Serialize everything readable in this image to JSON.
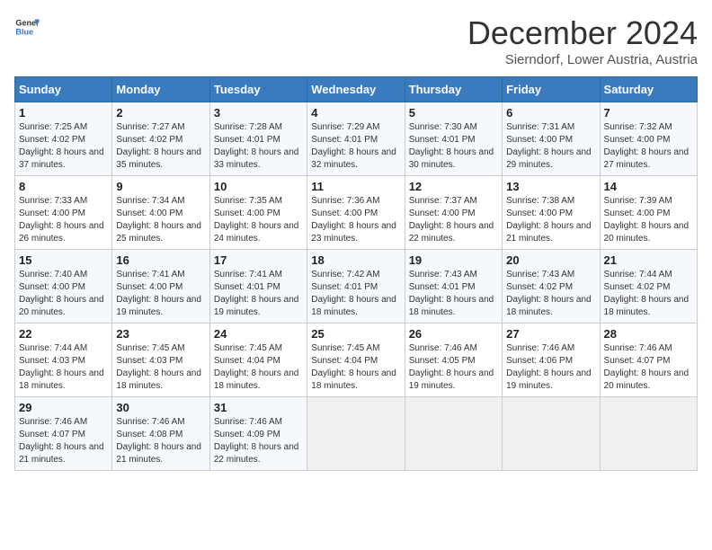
{
  "logo": {
    "general": "General",
    "blue": "Blue"
  },
  "title": "December 2024",
  "subtitle": "Sierndorf, Lower Austria, Austria",
  "days_of_week": [
    "Sunday",
    "Monday",
    "Tuesday",
    "Wednesday",
    "Thursday",
    "Friday",
    "Saturday"
  ],
  "weeks": [
    [
      {
        "day": "1",
        "sunrise": "Sunrise: 7:25 AM",
        "sunset": "Sunset: 4:02 PM",
        "daylight": "Daylight: 8 hours and 37 minutes."
      },
      {
        "day": "2",
        "sunrise": "Sunrise: 7:27 AM",
        "sunset": "Sunset: 4:02 PM",
        "daylight": "Daylight: 8 hours and 35 minutes."
      },
      {
        "day": "3",
        "sunrise": "Sunrise: 7:28 AM",
        "sunset": "Sunset: 4:01 PM",
        "daylight": "Daylight: 8 hours and 33 minutes."
      },
      {
        "day": "4",
        "sunrise": "Sunrise: 7:29 AM",
        "sunset": "Sunset: 4:01 PM",
        "daylight": "Daylight: 8 hours and 32 minutes."
      },
      {
        "day": "5",
        "sunrise": "Sunrise: 7:30 AM",
        "sunset": "Sunset: 4:01 PM",
        "daylight": "Daylight: 8 hours and 30 minutes."
      },
      {
        "day": "6",
        "sunrise": "Sunrise: 7:31 AM",
        "sunset": "Sunset: 4:00 PM",
        "daylight": "Daylight: 8 hours and 29 minutes."
      },
      {
        "day": "7",
        "sunrise": "Sunrise: 7:32 AM",
        "sunset": "Sunset: 4:00 PM",
        "daylight": "Daylight: 8 hours and 27 minutes."
      }
    ],
    [
      {
        "day": "8",
        "sunrise": "Sunrise: 7:33 AM",
        "sunset": "Sunset: 4:00 PM",
        "daylight": "Daylight: 8 hours and 26 minutes."
      },
      {
        "day": "9",
        "sunrise": "Sunrise: 7:34 AM",
        "sunset": "Sunset: 4:00 PM",
        "daylight": "Daylight: 8 hours and 25 minutes."
      },
      {
        "day": "10",
        "sunrise": "Sunrise: 7:35 AM",
        "sunset": "Sunset: 4:00 PM",
        "daylight": "Daylight: 8 hours and 24 minutes."
      },
      {
        "day": "11",
        "sunrise": "Sunrise: 7:36 AM",
        "sunset": "Sunset: 4:00 PM",
        "daylight": "Daylight: 8 hours and 23 minutes."
      },
      {
        "day": "12",
        "sunrise": "Sunrise: 7:37 AM",
        "sunset": "Sunset: 4:00 PM",
        "daylight": "Daylight: 8 hours and 22 minutes."
      },
      {
        "day": "13",
        "sunrise": "Sunrise: 7:38 AM",
        "sunset": "Sunset: 4:00 PM",
        "daylight": "Daylight: 8 hours and 21 minutes."
      },
      {
        "day": "14",
        "sunrise": "Sunrise: 7:39 AM",
        "sunset": "Sunset: 4:00 PM",
        "daylight": "Daylight: 8 hours and 20 minutes."
      }
    ],
    [
      {
        "day": "15",
        "sunrise": "Sunrise: 7:40 AM",
        "sunset": "Sunset: 4:00 PM",
        "daylight": "Daylight: 8 hours and 20 minutes."
      },
      {
        "day": "16",
        "sunrise": "Sunrise: 7:41 AM",
        "sunset": "Sunset: 4:00 PM",
        "daylight": "Daylight: 8 hours and 19 minutes."
      },
      {
        "day": "17",
        "sunrise": "Sunrise: 7:41 AM",
        "sunset": "Sunset: 4:01 PM",
        "daylight": "Daylight: 8 hours and 19 minutes."
      },
      {
        "day": "18",
        "sunrise": "Sunrise: 7:42 AM",
        "sunset": "Sunset: 4:01 PM",
        "daylight": "Daylight: 8 hours and 18 minutes."
      },
      {
        "day": "19",
        "sunrise": "Sunrise: 7:43 AM",
        "sunset": "Sunset: 4:01 PM",
        "daylight": "Daylight: 8 hours and 18 minutes."
      },
      {
        "day": "20",
        "sunrise": "Sunrise: 7:43 AM",
        "sunset": "Sunset: 4:02 PM",
        "daylight": "Daylight: 8 hours and 18 minutes."
      },
      {
        "day": "21",
        "sunrise": "Sunrise: 7:44 AM",
        "sunset": "Sunset: 4:02 PM",
        "daylight": "Daylight: 8 hours and 18 minutes."
      }
    ],
    [
      {
        "day": "22",
        "sunrise": "Sunrise: 7:44 AM",
        "sunset": "Sunset: 4:03 PM",
        "daylight": "Daylight: 8 hours and 18 minutes."
      },
      {
        "day": "23",
        "sunrise": "Sunrise: 7:45 AM",
        "sunset": "Sunset: 4:03 PM",
        "daylight": "Daylight: 8 hours and 18 minutes."
      },
      {
        "day": "24",
        "sunrise": "Sunrise: 7:45 AM",
        "sunset": "Sunset: 4:04 PM",
        "daylight": "Daylight: 8 hours and 18 minutes."
      },
      {
        "day": "25",
        "sunrise": "Sunrise: 7:45 AM",
        "sunset": "Sunset: 4:04 PM",
        "daylight": "Daylight: 8 hours and 18 minutes."
      },
      {
        "day": "26",
        "sunrise": "Sunrise: 7:46 AM",
        "sunset": "Sunset: 4:05 PM",
        "daylight": "Daylight: 8 hours and 19 minutes."
      },
      {
        "day": "27",
        "sunrise": "Sunrise: 7:46 AM",
        "sunset": "Sunset: 4:06 PM",
        "daylight": "Daylight: 8 hours and 19 minutes."
      },
      {
        "day": "28",
        "sunrise": "Sunrise: 7:46 AM",
        "sunset": "Sunset: 4:07 PM",
        "daylight": "Daylight: 8 hours and 20 minutes."
      }
    ],
    [
      {
        "day": "29",
        "sunrise": "Sunrise: 7:46 AM",
        "sunset": "Sunset: 4:07 PM",
        "daylight": "Daylight: 8 hours and 21 minutes."
      },
      {
        "day": "30",
        "sunrise": "Sunrise: 7:46 AM",
        "sunset": "Sunset: 4:08 PM",
        "daylight": "Daylight: 8 hours and 21 minutes."
      },
      {
        "day": "31",
        "sunrise": "Sunrise: 7:46 AM",
        "sunset": "Sunset: 4:09 PM",
        "daylight": "Daylight: 8 hours and 22 minutes."
      },
      null,
      null,
      null,
      null
    ]
  ]
}
